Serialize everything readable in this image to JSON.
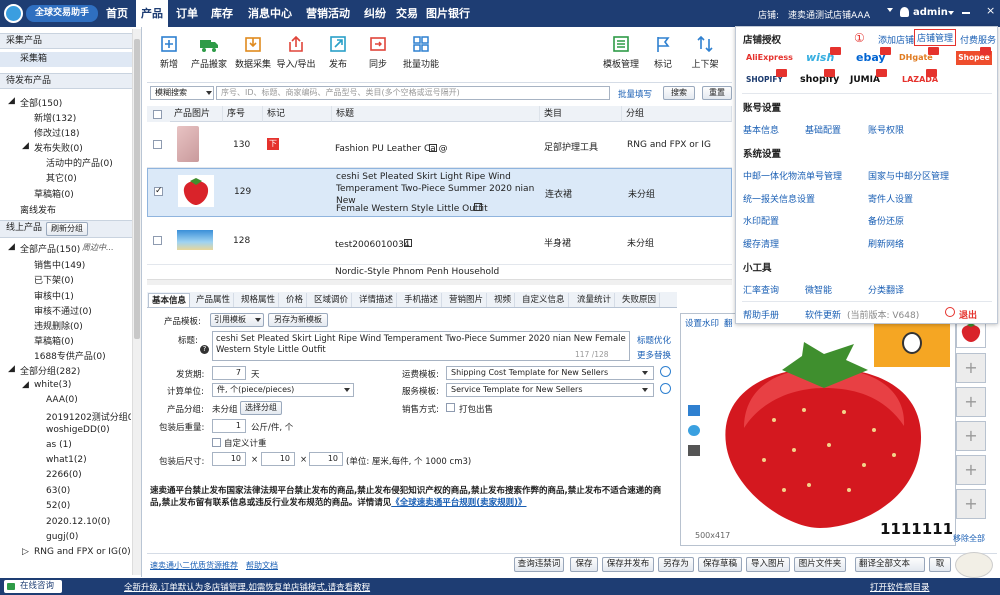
{
  "app": {
    "logo_text": "全球交易助手",
    "store_label": "店铺:",
    "store_value": "速卖通测试店铺AAA",
    "user": "admin"
  },
  "nav": [
    "首页",
    "产品",
    "订单",
    "库存",
    "消息中心",
    "营销活动",
    "纠纷",
    "交易",
    "图片银行"
  ],
  "sidebar": {
    "collect_header": "采集产品",
    "collect_box": "采集箱",
    "pending_header": "待发布产品",
    "pending": [
      "全部(150)",
      "新增(132)",
      "修改过(18)",
      "发布失败(0)",
      "活动中的产品(0)",
      "其它(0)",
      "草稿箱(0)",
      "离线发布"
    ],
    "online_header": "线上产品",
    "refresh_group": "刷新分组",
    "online": [
      "全部产品(150)",
      "周边中...",
      "销售中(149)",
      "已下架(0)",
      "审核中(1)",
      "审核不通过(0)",
      "违规删除(0)",
      "草稿箱(0)",
      "1688专供产品(0)"
    ],
    "groups": [
      "全部分组(282)",
      "white(3)",
      "AAA(0)",
      "20191202测试分组001",
      "woshigeDD(0)",
      "as (1)",
      "what1(2)",
      "2266(0)",
      "63(0)",
      "52(0)",
      "2020.12.10(0)",
      "gugj(0)",
      "RNG and FPX or IG(0)"
    ]
  },
  "toolbar": [
    "新增",
    "产品搬家",
    "数据采集",
    "导入/导出",
    "发布",
    "同步",
    "批量功能",
    "模板管理",
    "标记",
    "上下架"
  ],
  "search": {
    "mode": "模糊搜索",
    "placeholder": "序号、ID、标题、商家编码、产品型号、类目(多个空格或逗号隔开)",
    "batch": "批量填写",
    "search_btn": "搜索",
    "reset_btn": "重置"
  },
  "table": {
    "headers": [
      "产品图片",
      "序号",
      "标记",
      "标题",
      "类目",
      "分组"
    ],
    "rows": [
      {
        "seq": "130",
        "mark": "下",
        "title": "Fashion PU Leather Ca @",
        "category": "足部护理工具",
        "group": "RNG and FPX or IG"
      },
      {
        "seq": "129",
        "mark": "",
        "title": "ceshi Set Pleated Skirt Light Ripe Wind Temperament Two-Piece Summer 2020 nian New",
        "title2": "Female Western Style Little Outfit",
        "category": "连衣裙",
        "group": "未分组"
      },
      {
        "seq": "128",
        "mark": "",
        "title": "test2006010034",
        "category": "半身裙",
        "group": "未分组"
      },
      {
        "seq": "",
        "mark": "",
        "title": "Nordic-Style Phnom Penh Household",
        "category": "",
        "group": ""
      }
    ]
  },
  "tabs": [
    "基本信息",
    "产品属性",
    "规格属性",
    "价格",
    "区域调价",
    "详情描述",
    "手机描述",
    "营销图片",
    "视频",
    "自定义信息",
    "流量统计",
    "失败原因"
  ],
  "form": {
    "template_label": "产品模板:",
    "template_value": "引用模板",
    "save_template": "另存为新模板",
    "title_label": "标题:",
    "title_value": "ceshi Set Pleated Skirt Light Ripe Wind Temperament Two-Piece Summer 2020 nian New Female Western Style Little Outfit",
    "title_count": "117 /128",
    "title_opt": "标题优化",
    "more_replace": "更多替换",
    "ship_label": "发货期:",
    "ship_value": "7",
    "ship_unit": "天",
    "freight_label": "运费模板:",
    "freight_value": "Shipping Cost Template for New Sellers",
    "unit_label": "计算单位:",
    "unit_value": "件, 个(piece/pieces)",
    "service_label": "服务模板:",
    "service_value": "Service Template for New Sellers",
    "group_label": "产品分组:",
    "group_value": "未分组",
    "choose_group": "选择分组",
    "sale_label": "销售方式:",
    "sale_value": "打包出售",
    "weight_label": "包装后重量:",
    "weight_value": "1",
    "weight_unit": "公斤/件, 个",
    "custom_weight": "自定义计重",
    "size_label": "包装后尺寸:",
    "size_l": "10",
    "size_w": "10",
    "size_h": "10",
    "size_unit": "(单位: 厘米,每件, 个  1000 cm3)",
    "notice": "速卖通平台禁止发布国家法律法规平台禁止发布的商品,禁止发布侵犯知识产权的商品,禁止发布搜索作弊的商品,禁止发布不适合速递的商品,禁止发布留有联系信息或违反行业发布规范的商品。详情请见",
    "notice_link": "《全球速卖通平台规则(卖家规则)》"
  },
  "image_panel": {
    "watermark": "设置水印",
    "translate": "翻",
    "size": "500x417",
    "code": "1111111",
    "delete_all": "移除全部"
  },
  "bottom_links": {
    "left1": "速卖通小二优质货源推荐",
    "left2": "帮助文档"
  },
  "bottom_buttons": [
    "查询违禁词",
    "保存",
    "保存并发布",
    "另存为",
    "保存草稿",
    "导入图片",
    "图片文件夹",
    "翻译全部文本",
    "取"
  ],
  "statusbar": {
    "online": "在线咨询",
    "msg": "全新升级,订单默认为多店铺管理,如需恢复单店铺模式,请查看教程",
    "open_folder": "打开软件根目录"
  },
  "popup": {
    "store_auth": "店铺授权",
    "add_store": "添加店铺",
    "store_manage": "店铺管理",
    "pay_service": "付费服务",
    "annotation": "①",
    "platforms": [
      "AliExpress",
      "wish",
      "ebay",
      "DHgate",
      "Shopee",
      "SHOPIFY",
      "shopify",
      "JUMIA",
      "LAZADA"
    ],
    "account_settings": "账号设置",
    "account_links": [
      "基本信息",
      "基础配置",
      "账号权限"
    ],
    "system_settings": "系统设置",
    "system_links": [
      "中邮一体化物流单号管理",
      "国家与中邮分区管理",
      "统一报关信息设置",
      "寄件人设置",
      "水印配置",
      "备份还原",
      "缓存清理",
      "刷新网络"
    ],
    "tools": "小工具",
    "tool_links": [
      "汇率查询",
      "微智能",
      "分类翻译"
    ],
    "help": "帮助手册",
    "update": "软件更新",
    "version": "(当前版本: V648)",
    "exit": "退出"
  },
  "colors": {
    "nav_bg": "#1e3d73",
    "link": "#1a5fb4",
    "red": "#e5322d",
    "selected_row": "#dbe9f8"
  }
}
